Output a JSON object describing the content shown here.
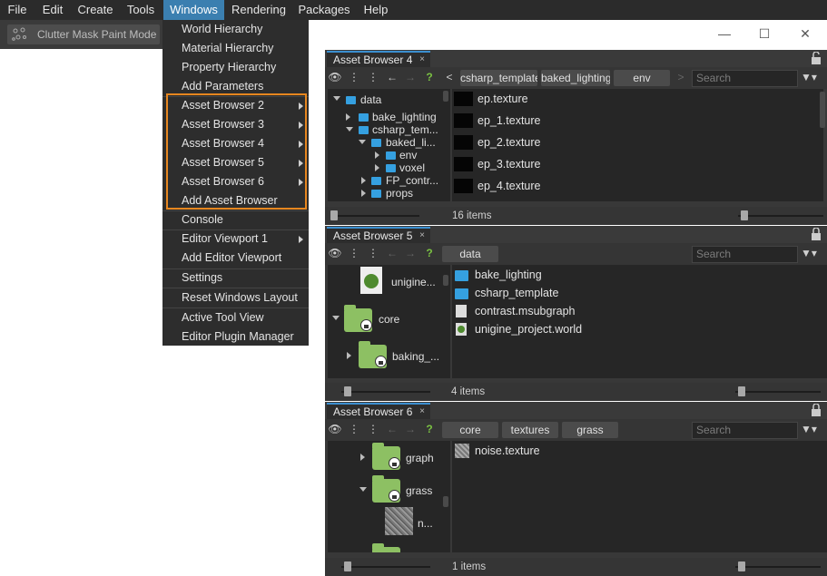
{
  "menubar": {
    "items": [
      "File",
      "Edit",
      "Create",
      "Tools",
      "Windows",
      "Rendering",
      "Packages",
      "Help"
    ],
    "active": "Windows"
  },
  "toolbar": {
    "tool_label": "Clutter Mask Paint Mode"
  },
  "windows_menu": {
    "items": [
      {
        "label": "World Hierarchy",
        "submenu": false
      },
      {
        "label": "Material Hierarchy",
        "submenu": false
      },
      {
        "label": "Property Hierarchy",
        "submenu": false
      },
      {
        "label": "Add Parameters",
        "submenu": false
      },
      {
        "label": "Asset Browser 2",
        "submenu": true
      },
      {
        "label": "Asset Browser 3",
        "submenu": true
      },
      {
        "label": "Asset Browser 4",
        "submenu": true
      },
      {
        "label": "Asset Browser 5",
        "submenu": true
      },
      {
        "label": "Asset Browser 6",
        "submenu": true
      },
      {
        "label": "Add Asset Browser",
        "submenu": false
      },
      {
        "label": "Console",
        "submenu": false
      },
      {
        "label": "Editor Viewport 1",
        "submenu": true
      },
      {
        "label": "Add Editor Viewport",
        "submenu": false
      },
      {
        "label": "Settings",
        "submenu": false
      },
      {
        "label": "Reset Windows Layout",
        "submenu": false
      },
      {
        "label": "Active Tool View",
        "submenu": false
      },
      {
        "label": "Editor Plugin Manager",
        "submenu": false
      }
    ],
    "highlight_color": "#e6861f"
  },
  "window_controls": {
    "minimize": "—",
    "maximize": "☐",
    "close": "✕"
  },
  "asset_browser_4": {
    "tab": "Asset Browser 4",
    "close": "×",
    "back_chevron": "<",
    "forward_chevron": ">",
    "breadcrumbs": [
      "csharp_template",
      "baked_lighting",
      "env"
    ],
    "search_placeholder": "Search",
    "tree": [
      {
        "label": "data"
      },
      {
        "label": "bake_lighting"
      },
      {
        "label": "csharp_tem..."
      },
      {
        "label": "baked_li..."
      },
      {
        "label": "env"
      },
      {
        "label": "voxel"
      },
      {
        "label": "FP_contr..."
      },
      {
        "label": "props"
      }
    ],
    "files": [
      "ep.texture",
      "ep_1.texture",
      "ep_2.texture",
      "ep_3.texture",
      "ep_4.texture"
    ],
    "status": "16 items"
  },
  "asset_browser_5": {
    "tab": "Asset Browser 5",
    "close": "×",
    "breadcrumbs": [
      "data"
    ],
    "search_placeholder": "Search",
    "tree": [
      {
        "label": "unigine..."
      },
      {
        "label": "core"
      },
      {
        "label": "baking_..."
      }
    ],
    "files": [
      "bake_lighting",
      "csharp_template",
      "contrast.msubgraph",
      "unigine_project.world"
    ],
    "status": "4 items"
  },
  "asset_browser_6": {
    "tab": "Asset Browser 6",
    "close": "×",
    "breadcrumbs": [
      "core",
      "textures",
      "grass"
    ],
    "search_placeholder": "Search",
    "tree": [
      {
        "label": "graph"
      },
      {
        "label": "grass"
      },
      {
        "label": "n..."
      }
    ],
    "files": [
      "noise.texture"
    ],
    "status": "1 items"
  },
  "colors": {
    "accent": "#3b7fb0",
    "tab_accent": "#3b8fd0",
    "folder_small": "#35a0e0",
    "folder_big": "#8dc063",
    "help": "#7ac142"
  }
}
